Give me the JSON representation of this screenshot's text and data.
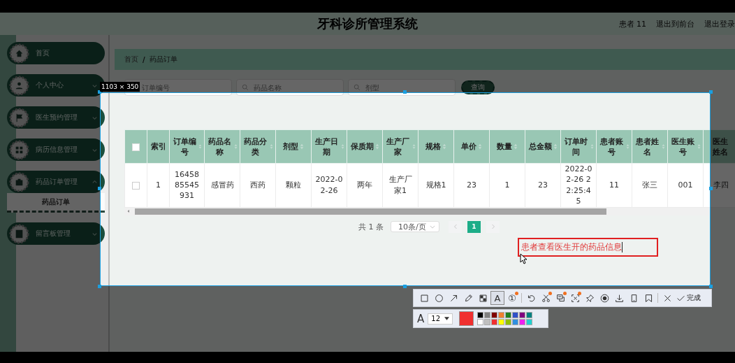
{
  "header": {
    "title": "牙科诊所管理系统",
    "user": "患者 11",
    "links": [
      "退出到前台",
      "退出登录"
    ]
  },
  "sidebar": {
    "items": [
      {
        "label": "首页"
      },
      {
        "label": "个人中心",
        "expanded": false
      },
      {
        "label": "医生预约管理",
        "expanded": false
      },
      {
        "label": "病历信息管理",
        "expanded": false
      },
      {
        "label": "药品订单管理",
        "expanded": true,
        "children": [
          {
            "label": "药品订单",
            "selected": true
          }
        ]
      },
      {
        "label": "留言板管理",
        "expanded": false
      }
    ]
  },
  "breadcrumb": {
    "items": [
      "首页",
      "药品订单"
    ],
    "separator": "/"
  },
  "search": {
    "fields": [
      {
        "placeholder": "订单编号"
      },
      {
        "placeholder": "药品名称"
      },
      {
        "placeholder": "剂型"
      }
    ],
    "button": "查询"
  },
  "table": {
    "header_checked": false,
    "columns": [
      {
        "label": "索引",
        "sortable": false
      },
      {
        "label": "订单编号",
        "sortable": true
      },
      {
        "label": "药品名称",
        "sortable": true
      },
      {
        "label": "药品分类",
        "sortable": true
      },
      {
        "label": "剂型",
        "sortable": true
      },
      {
        "label": "生产日期",
        "sortable": true
      },
      {
        "label": "保质期",
        "sortable": true
      },
      {
        "label": "生产厂家",
        "sortable": true
      },
      {
        "label": "规格",
        "sortable": true
      },
      {
        "label": "单价",
        "sortable": true
      },
      {
        "label": "数量",
        "sortable": true
      },
      {
        "label": "总金额",
        "sortable": true
      },
      {
        "label": "订单时间",
        "sortable": true
      },
      {
        "label": "患者账号",
        "sortable": true
      },
      {
        "label": "患者姓名",
        "sortable": true
      },
      {
        "label": "医生账号",
        "sortable": true
      },
      {
        "label": "医生姓名"
      }
    ],
    "rows": [
      {
        "checked": false,
        "cells": [
          "1",
          "1645885545931",
          "感冒药",
          "西药",
          "颗粒",
          "2022-02-26",
          "两年",
          "生产厂家1",
          "规格1",
          "23",
          "1",
          "23",
          "2022-02-26 22:25:45",
          "11",
          "张三",
          "001",
          "李四"
        ]
      }
    ]
  },
  "pagination": {
    "total": "共 1 条",
    "page_size": "10条/页",
    "pages": [
      {
        "label": "1",
        "selected": true
      }
    ]
  },
  "capture": {
    "size": "1103 × 350",
    "annotation": "患者查看医生开的药品信息",
    "tools": [
      {
        "selected": false,
        "badge": false
      },
      {
        "selected": false,
        "badge": false
      },
      {
        "selected": false,
        "badge": false
      },
      {
        "selected": false,
        "badge": false
      },
      {
        "selected": false,
        "badge": false
      },
      {
        "glyph": "A",
        "selected": true,
        "badge": false
      },
      {
        "glyph": "①",
        "selected": false,
        "badge": true
      },
      {
        "selected": false,
        "badge": false
      },
      {
        "selected": false,
        "badge": true
      },
      {
        "selected": false,
        "badge": true
      },
      {
        "selected": false,
        "badge": true
      },
      {
        "selected": false,
        "badge": false
      },
      {
        "selected": false,
        "badge": false
      },
      {
        "selected": false,
        "badge": false
      },
      {
        "selected": false,
        "badge": false
      },
      {
        "selected": false,
        "badge": false
      },
      {
        "selected": false,
        "badge": false
      }
    ],
    "done": "完成",
    "text_style": {
      "glyph": "A",
      "font_size": "12",
      "color": "#f03030"
    },
    "palette": [
      {
        "color": "#000000"
      },
      {
        "color": "#808080"
      },
      {
        "color": "#800000"
      },
      {
        "color": "#f08030"
      },
      {
        "color": "#208020"
      },
      {
        "color": "#3050c8"
      },
      {
        "color": "#800080"
      },
      {
        "color": "#008080"
      },
      {
        "color": "#ffffff"
      },
      {
        "color": "#c0c0c0"
      },
      {
        "color": "#f03030"
      },
      {
        "color": "#ffff00"
      },
      {
        "color": "#90c000"
      },
      {
        "color": "#3090e0"
      },
      {
        "color": "#f020f0"
      },
      {
        "color": "#20d0d0"
      }
    ]
  }
}
